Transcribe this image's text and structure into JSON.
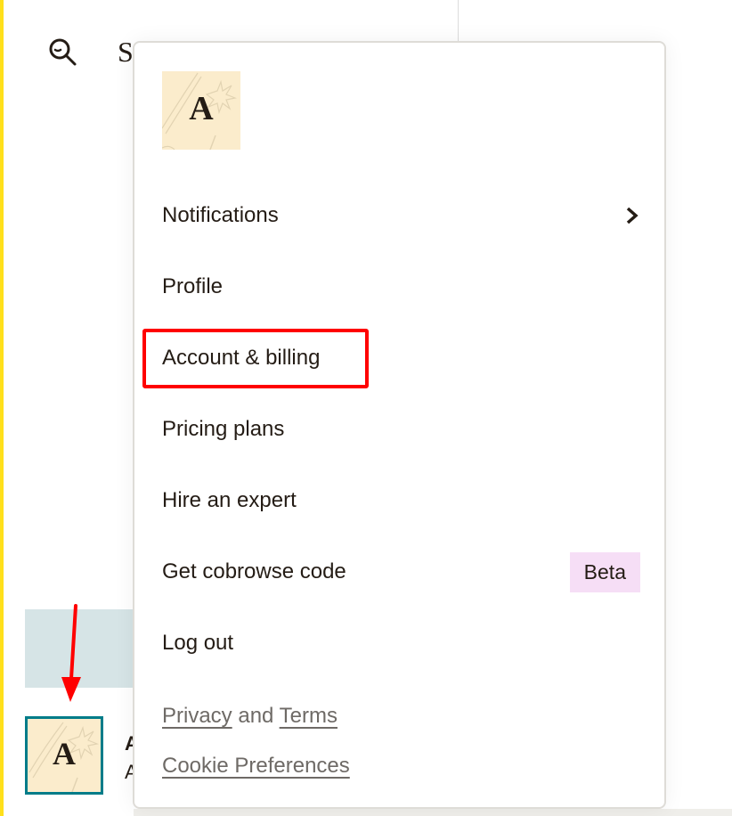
{
  "sidebar": {
    "search_label": "S",
    "search_icon": "search-icon",
    "account_name_initial": "A",
    "account_sub_initial": "A",
    "avatar_initial": "A",
    "accent_color": "#ffe01b",
    "avatar_border_color": "#007c89"
  },
  "dropdown": {
    "avatar_initial": "A",
    "items": [
      {
        "label": "Notifications",
        "icon": "chevron-right-icon"
      },
      {
        "label": "Profile"
      },
      {
        "label": "Account & billing"
      },
      {
        "label": "Pricing plans"
      },
      {
        "label": "Hire an expert"
      },
      {
        "label": "Get cobrowse code",
        "badge": "Beta"
      },
      {
        "label": "Log out"
      }
    ],
    "legal": {
      "privacy": "Privacy",
      "and": "and",
      "terms": "Terms",
      "cookies": "Cookie Preferences"
    }
  },
  "annotations": {
    "highlight_color": "#ff0000",
    "highlighted_item": "Account & billing"
  }
}
